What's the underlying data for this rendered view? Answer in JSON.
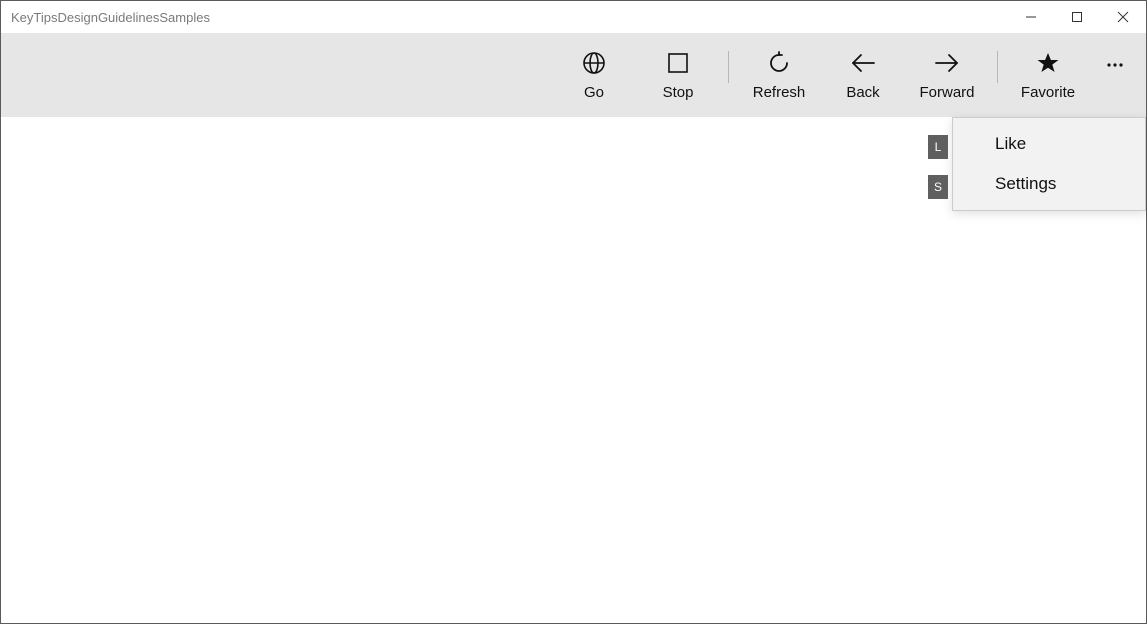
{
  "window": {
    "title": "KeyTipsDesignGuidelinesSamples"
  },
  "toolbar": {
    "items": [
      {
        "id": "go",
        "label": "Go"
      },
      {
        "id": "stop",
        "label": "Stop"
      },
      {
        "id": "refresh",
        "label": "Refresh"
      },
      {
        "id": "back",
        "label": "Back"
      },
      {
        "id": "forward",
        "label": "Forward"
      },
      {
        "id": "favorite",
        "label": "Favorite"
      }
    ]
  },
  "flyout": {
    "items": [
      {
        "key": "L",
        "label": "Like"
      },
      {
        "key": "S",
        "label": "Settings"
      }
    ]
  }
}
